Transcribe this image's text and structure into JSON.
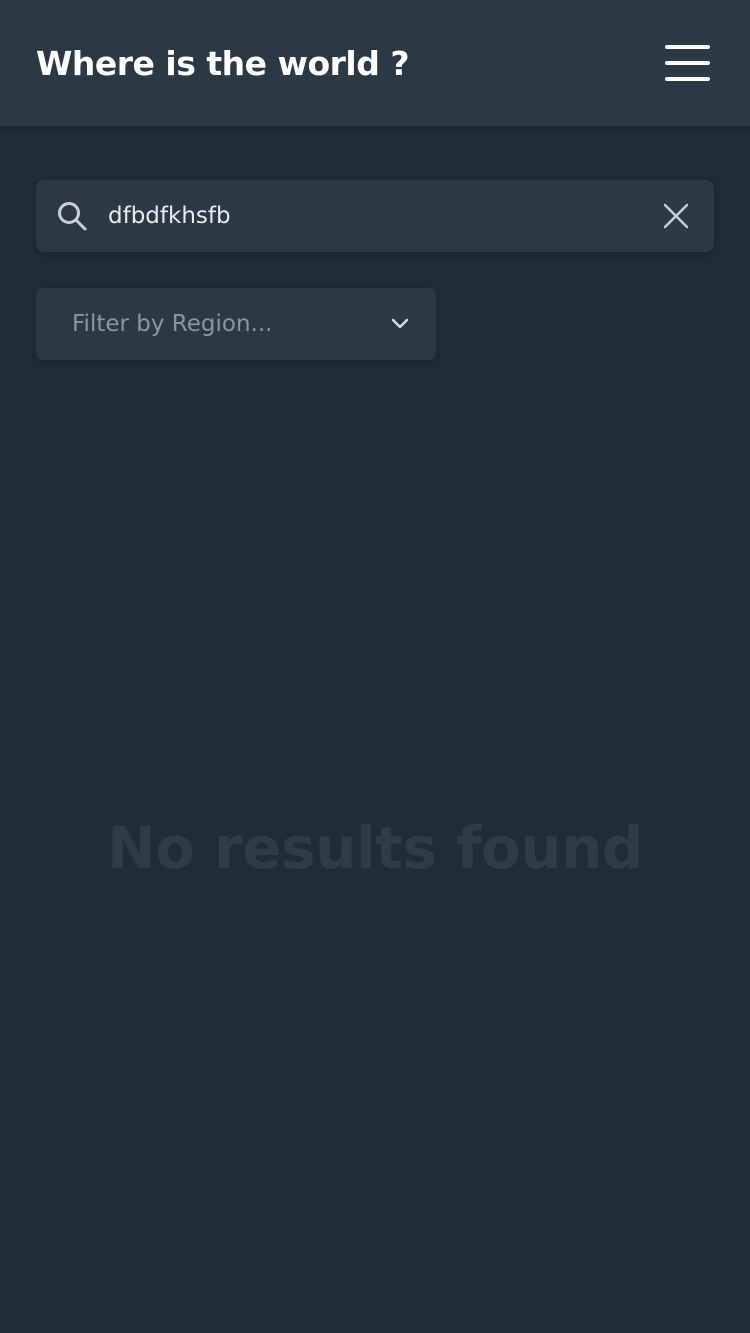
{
  "header": {
    "title": "Where is the world ?",
    "menu_icon": "hamburger-menu-icon"
  },
  "search": {
    "value": "dfbdfkhsfb",
    "search_icon": "search-icon",
    "clear_icon": "close-icon"
  },
  "filter": {
    "placeholder": "Filter by Region...",
    "chevron_icon": "chevron-down-icon"
  },
  "results": {
    "empty_message": "No results found"
  },
  "colors": {
    "background": "#202c37",
    "surface": "#2b3945",
    "text_primary": "#ffffff",
    "text_muted": "#8d969e",
    "empty_text": "#2f3c48"
  }
}
